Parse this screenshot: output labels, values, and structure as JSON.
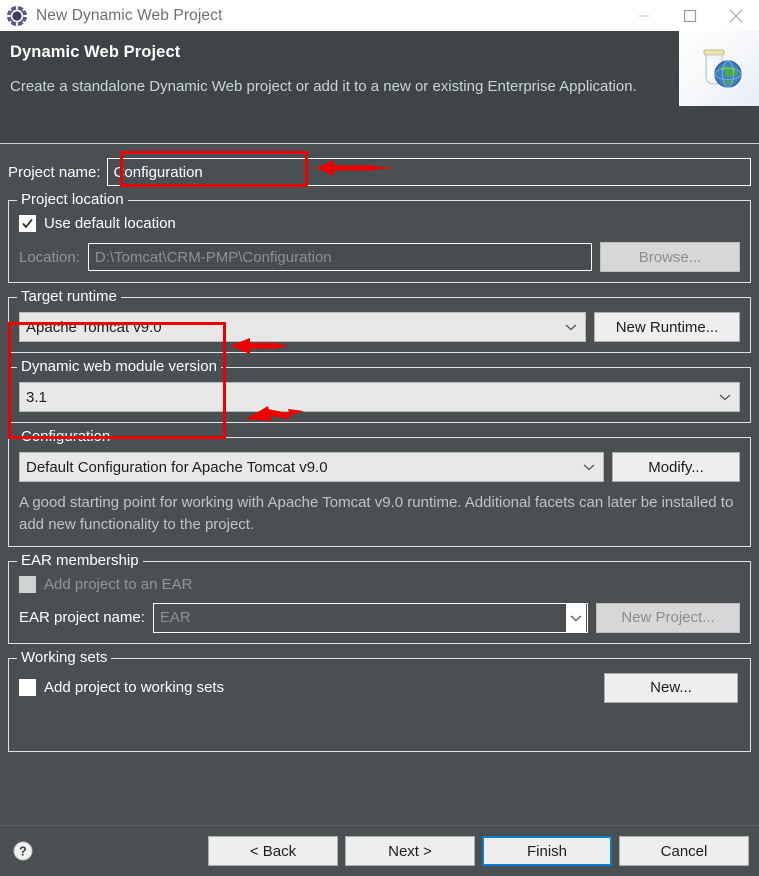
{
  "window": {
    "title": "New Dynamic Web Project",
    "icon": "eclipse-gear-icon",
    "minimize_label": "Minimize",
    "maximize_label": "Maximize",
    "close_label": "Close"
  },
  "header": {
    "title": "Dynamic Web Project",
    "description": "Create a standalone Dynamic Web project or add it to a new or existing Enterprise Application.",
    "banner_icon": "jar-globe-icon"
  },
  "project_name": {
    "label": "Project name:",
    "label_mnemonic": "m",
    "value": "Configuration",
    "placeholder": ""
  },
  "project_location": {
    "legend": "Project location",
    "use_default": {
      "label": "Use default location",
      "mnemonic": "d",
      "checked": true
    },
    "location": {
      "label": "Location:",
      "mnemonic": "L",
      "value": "D:\\Tomcat\\CRM-PMP\\Configuration",
      "disabled": true
    },
    "browse_button": {
      "label": "Browse...",
      "mnemonic": "e",
      "disabled": true
    }
  },
  "target_runtime": {
    "legend": "Target runtime",
    "legend_mnemonic": "r",
    "selected": "Apache Tomcat v9.0",
    "options": [
      "Apache Tomcat v9.0"
    ],
    "new_runtime_button": {
      "label": "New Runtime...",
      "mnemonic": "R"
    }
  },
  "module_version": {
    "legend": "Dynamic web module version",
    "legend_mnemonic": "v",
    "selected": "3.1",
    "options": [
      "3.1"
    ]
  },
  "configuration": {
    "legend": "Configuration",
    "legend_mnemonic": "C",
    "selected": "Default Configuration for Apache Tomcat v9.0",
    "options": [
      "Default Configuration for Apache Tomcat v9.0"
    ],
    "modify_button": {
      "label": "Modify...",
      "mnemonic": "if"
    },
    "description": "A good starting point for working with Apache Tomcat v9.0 runtime. Additional facets can later be installed to add new functionality to the project."
  },
  "ear_membership": {
    "legend": "EAR membership",
    "add_to_ear": {
      "label": "Add project to an EAR",
      "checked": false,
      "disabled": true
    },
    "ear_project_name": {
      "label": "EAR project name:",
      "mnemonic": "A",
      "value": "EAR",
      "disabled": true
    },
    "new_project_button": {
      "label": "New Project...",
      "mnemonic": "P",
      "disabled": true
    }
  },
  "working_sets": {
    "legend": "Working sets",
    "add_to_working_sets": {
      "label": "Add project to working sets",
      "mnemonic": "t",
      "checked": false
    },
    "new_button": {
      "label": "New...",
      "mnemonic": "w"
    }
  },
  "footer": {
    "help_icon": "help-question-icon",
    "buttons": [
      {
        "label": "< Back",
        "mnemonic": "B",
        "focused": false
      },
      {
        "label": "Next >",
        "mnemonic": "N",
        "focused": false
      },
      {
        "label": "Finish",
        "mnemonic": "F",
        "focused": true
      },
      {
        "label": "Cancel",
        "mnemonic": "",
        "focused": false
      }
    ]
  },
  "annotations": {
    "accent_color": "#ef0000",
    "boxes": [
      {
        "name": "project-name-highlight"
      },
      {
        "name": "runtime-version-highlight"
      }
    ],
    "arrows": [
      {
        "name": "arrow-project-name"
      },
      {
        "name": "arrow-target-runtime"
      },
      {
        "name": "arrow-module-version"
      }
    ]
  }
}
